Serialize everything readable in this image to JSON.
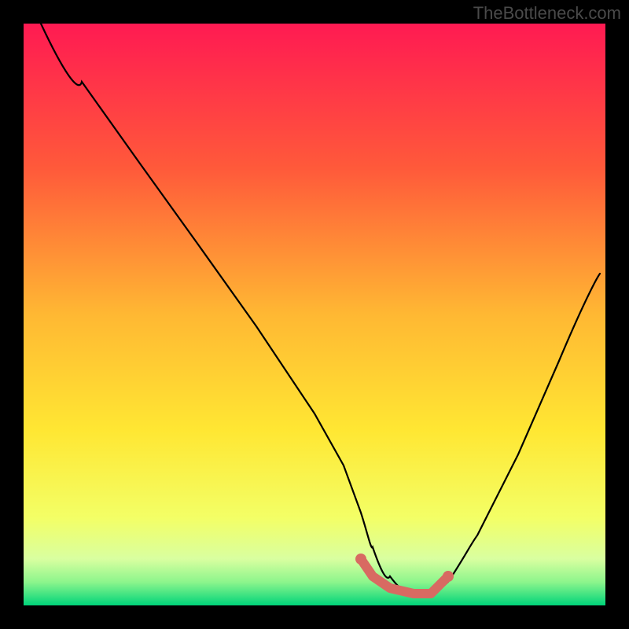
{
  "attribution": "TheBottleneck.com",
  "chart_data": {
    "type": "line",
    "title": "",
    "xlabel": "",
    "ylabel": "",
    "xlim": [
      0,
      100
    ],
    "ylim": [
      0,
      100
    ],
    "gradient_stops": [
      {
        "pct": 0,
        "color": "#ff1a52"
      },
      {
        "pct": 25,
        "color": "#ff5a3a"
      },
      {
        "pct": 50,
        "color": "#ffb833"
      },
      {
        "pct": 70,
        "color": "#ffe733"
      },
      {
        "pct": 85,
        "color": "#f3ff66"
      },
      {
        "pct": 92,
        "color": "#d9ffa0"
      },
      {
        "pct": 96,
        "color": "#8cf58c"
      },
      {
        "pct": 100,
        "color": "#00d47a"
      }
    ],
    "series": [
      {
        "name": "bottleneck-curve",
        "color": "#000000",
        "x": [
          3,
          10,
          20,
          30,
          40,
          50,
          55,
          58,
          60,
          63,
          67,
          70,
          73,
          78,
          85,
          92,
          99
        ],
        "y": [
          100,
          90,
          76,
          62,
          48,
          33,
          24,
          16,
          10,
          5,
          2,
          2,
          4,
          12,
          26,
          42,
          57
        ]
      }
    ],
    "highlight_segment": {
      "name": "optimal-range",
      "color": "#d86a62",
      "x": [
        58,
        60,
        63,
        67,
        70,
        73
      ],
      "y": [
        8,
        5,
        3,
        2,
        2,
        5
      ]
    }
  }
}
